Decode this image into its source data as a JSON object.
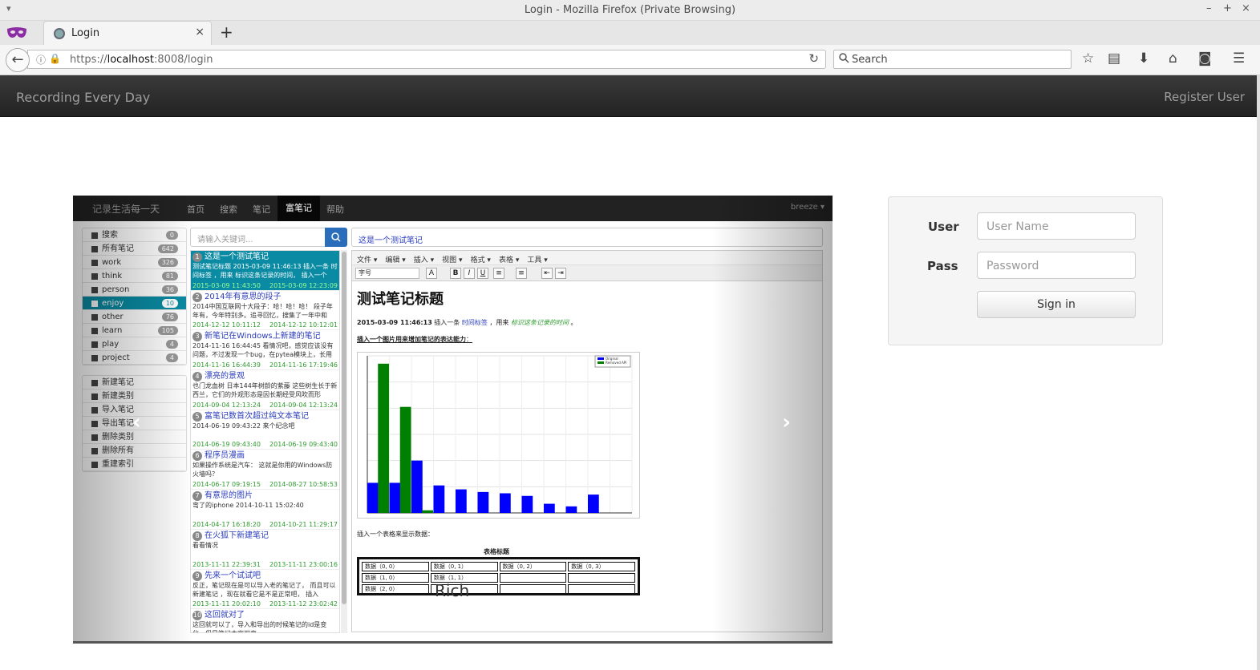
{
  "window": {
    "title": "Login - Mozilla Firefox (Private Browsing)"
  },
  "tab": {
    "label": "Login",
    "new_tab": "+"
  },
  "url": {
    "scheme": "https://",
    "host": "localhost",
    "rest": ":8008/login"
  },
  "search": {
    "placeholder": "Search"
  },
  "app": {
    "brand": "Recording Every Day",
    "register": "Register User"
  },
  "screenshot": {
    "nav": {
      "brand": "记录生活每一天",
      "items": [
        "首页",
        "搜索",
        "笔记",
        "富笔记",
        "帮助"
      ],
      "active": "富笔记",
      "user": "breeze ▾"
    },
    "sidebar": {
      "categories": [
        {
          "label": "搜索",
          "count": "0"
        },
        {
          "label": "所有笔记",
          "count": "642"
        },
        {
          "label": "work",
          "count": "326"
        },
        {
          "label": "think",
          "count": "81"
        },
        {
          "label": "person",
          "count": "36"
        },
        {
          "label": "enjoy",
          "count": "10"
        },
        {
          "label": "other",
          "count": "76"
        },
        {
          "label": "learn",
          "count": "105"
        },
        {
          "label": "play",
          "count": "4"
        },
        {
          "label": "project",
          "count": "4"
        }
      ],
      "actions": [
        "新建笔记",
        "新建类别",
        "导入笔记",
        "导出笔记",
        "删除类别",
        "删除所有",
        "重建索引"
      ]
    },
    "search_placeholder": "请输入关键词...",
    "notes": [
      {
        "n": "1",
        "title": "这是一个测试笔记",
        "snippet": "测试笔记标题 2015-03-09 11:46:13 插入一条 时间标签 ，用来 标识这条记录的时间， 插入一个",
        "d1": "2015-03-09 11:43:50",
        "d2": "2015-03-09 12:23:09"
      },
      {
        "n": "2",
        "title": "2014年有意思的段子",
        "snippet": "2014中国互联网十大段子：哈！哈！哈！ 段子年年有，今年特别多。追寻回忆，搜集了一年中和",
        "d1": "2014-12-12 10:11:12",
        "d2": "2014-12-12 10:12:01"
      },
      {
        "n": "3",
        "title": "新笔记在Windows上新建的笔记",
        "snippet": "2014-11-16 16:44:45 看情况吧，感觉应该没有问题，不过发现一个bug，在pytea模块上，长用Lin",
        "d1": "2014-11-16 16:44:39",
        "d2": "2014-11-16 17:19:46"
      },
      {
        "n": "4",
        "title": "漂亮的景观",
        "snippet": "也门龙血树 日本144年树龄的紫藤 这些树生长于新西兰，它们的外观形态是因长期经受风吹而形",
        "d1": "2014-09-04 12:13:24",
        "d2": "2014-09-04 12:13:24"
      },
      {
        "n": "5",
        "title": "富笔记数首次超过纯文本笔记",
        "snippet": "2014-06-19 09:43:22 来个纪念吧",
        "d1": "2014-06-19 09:43:40",
        "d2": "2014-06-19 09:43:40"
      },
      {
        "n": "6",
        "title": "程序员漫画",
        "snippet": "如果操作系统是汽车： 这就是你用的Windows防火墙吗？",
        "d1": "2014-06-17 09:19:15",
        "d2": "2014-08-27 10:58:53"
      },
      {
        "n": "7",
        "title": "有意思的图片",
        "snippet": "弯了的iphone 2014-10-11 15:02:40",
        "d1": "2014-04-17 16:18:20",
        "d2": "2014-10-21 11:29:17"
      },
      {
        "n": "8",
        "title": "在火狐下新建笔记",
        "snippet": "看看情况",
        "d1": "2013-11-11 22:39:31",
        "d2": "2013-11-11 23:00:16"
      },
      {
        "n": "9",
        "title": "先来一个试试吧",
        "snippet": "反正，笔记现在是可以导入老的笔记了， 而且可以新建笔记 ，现在就看它是不是正常吧， 插入",
        "d1": "2013-11-11 20:02:10",
        "d2": "2013-11-12 23:02:42"
      },
      {
        "n": "10",
        "title": "这回就对了",
        "snippet": "这回就可以了，导入和导出的时候笔记的id是变化，但是笔记本家可直",
        "d1": "",
        "d2": ""
      }
    ],
    "editor": {
      "title_value": "这是一个测试笔记",
      "menus": [
        "文件 ▾",
        "编辑 ▾",
        "插入 ▾",
        "视图 ▾",
        "格式 ▾",
        "表格 ▾",
        "工具 ▾"
      ],
      "fontsize": "字号",
      "heading": "测试笔记标题",
      "ts": "2015-03-09 11:46:13",
      "p1a": " 插入一条 ",
      "p1link": "时间标签",
      "p1b": " ，用来 ",
      "p1green": "标识这条记录的时间",
      "p1c": " 。",
      "p2": "插入一个图片用来增加笔记的表达能力",
      "p2end": "：",
      "p3": "插入一个表格来显示数据：",
      "table_caption": "表格标题",
      "table": [
        [
          "数据（0, 0）",
          "数据（0, 1）",
          "数据（0, 2）",
          "数据（0, 3）"
        ],
        [
          "数据（1, 0）",
          "数据（1, 1）",
          "",
          ""
        ],
        [
          "数据（2, 0）",
          "",
          "",
          ""
        ]
      ],
      "rich_label": "Rich"
    },
    "chart_legend": [
      "Original",
      "Removed API"
    ],
    "chart_data": {
      "type": "bar",
      "series": [
        {
          "name": "Original",
          "color": "#0000ff",
          "values": [
            1150,
            1150,
            2000,
            1050,
            900,
            800,
            750,
            650,
            350,
            250,
            700,
            0
          ]
        },
        {
          "name": "Removed API",
          "color": "#008000",
          "values": [
            5700,
            4050,
            100,
            0,
            0,
            0,
            0,
            0,
            0,
            0,
            0,
            0
          ]
        }
      ],
      "ylim": [
        0,
        6000
      ]
    }
  },
  "login": {
    "user_label": "User",
    "user_placeholder": "User Name",
    "pass_label": "Pass",
    "pass_placeholder": "Password",
    "signin": "Sign in"
  }
}
